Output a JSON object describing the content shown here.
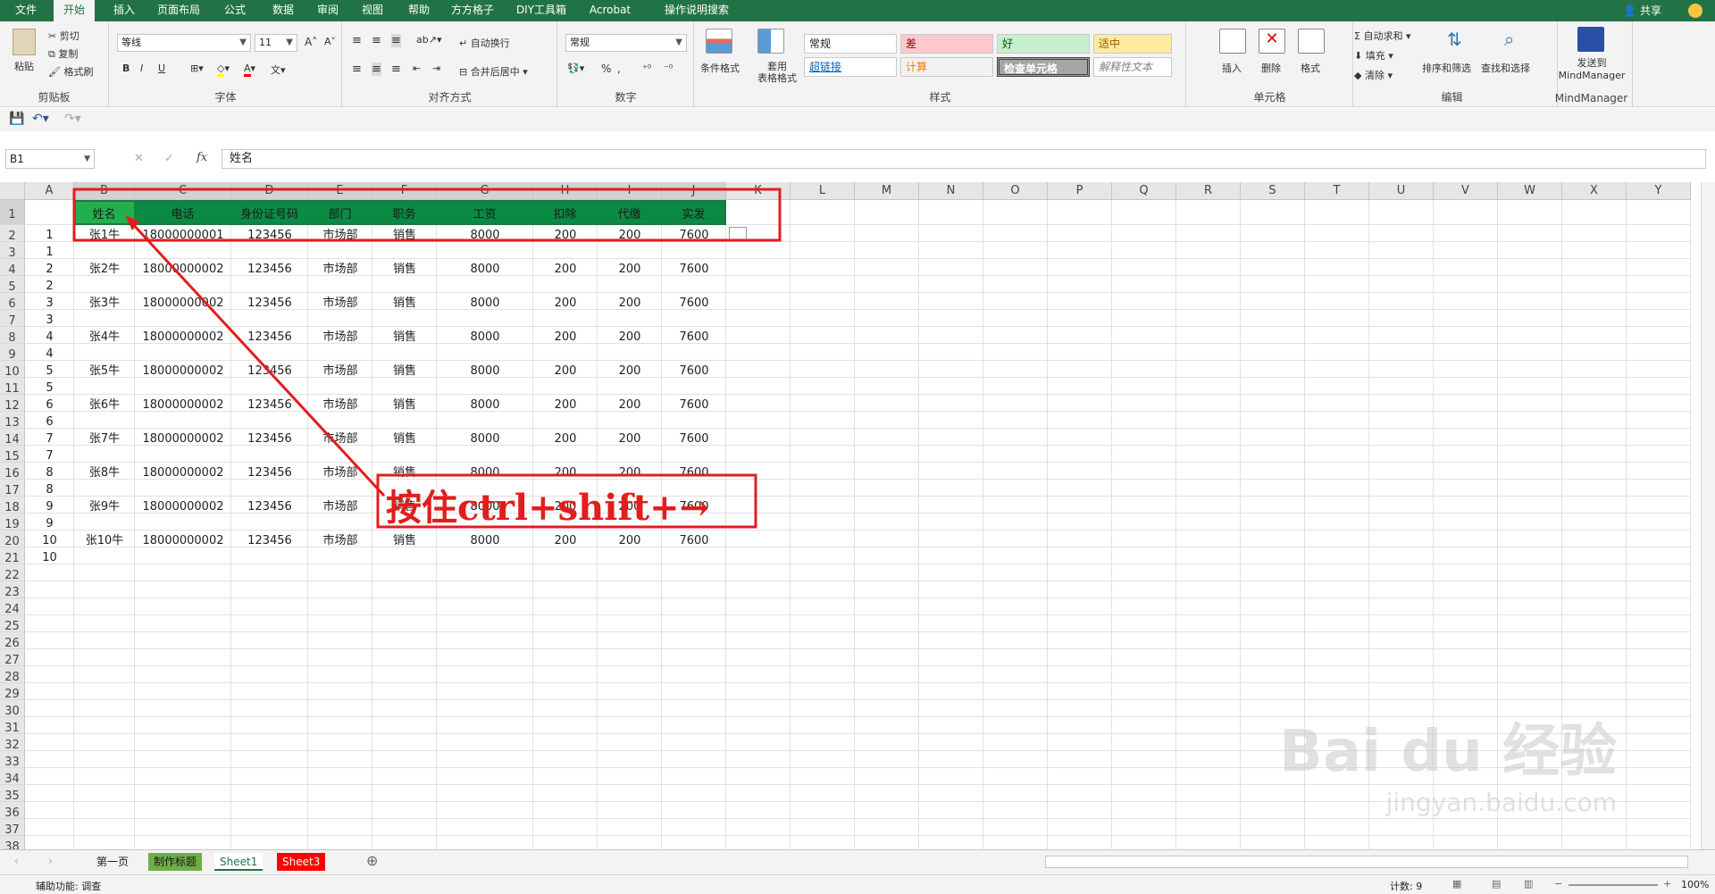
{
  "ribbon_tabs": [
    "文件",
    "开始",
    "插入",
    "页面布局",
    "公式",
    "数据",
    "审阅",
    "视图",
    "帮助",
    "方方格子",
    "DIY工具箱",
    "Acrobat",
    "操作说明搜索"
  ],
  "active_tab": "开始",
  "share_label": "共享",
  "clipboard": {
    "paste": "粘贴",
    "cut": "剪切",
    "copy": "复制",
    "format_painter": "格式刷",
    "label": "剪贴板"
  },
  "font": {
    "name": "等线",
    "size": "11",
    "label": "字体",
    "bold": "B",
    "italic": "I",
    "underline": "U"
  },
  "alignment": {
    "wrap": "自动换行",
    "merge": "合并后居中",
    "label": "对齐方式"
  },
  "number": {
    "format": "常规",
    "percent": "%",
    "comma": ",",
    "label": "数字"
  },
  "styles": {
    "conditional": "条件格式",
    "table": "套用\n表格格式",
    "items": [
      "常规",
      "差",
      "好",
      "适中",
      "超链接",
      "计算",
      "检查单元格",
      "解释性文本"
    ],
    "label": "样式"
  },
  "cells": {
    "insert": "插入",
    "delete": "删除",
    "format": "格式",
    "label": "单元格"
  },
  "editing": {
    "autosum": "自动求和",
    "fill": "填充",
    "clear": "清除",
    "sort": "排序和筛选",
    "find": "查找和选择",
    "label": "编辑"
  },
  "mindmanager": {
    "send": "发送到\nMindManager",
    "label": "MindManager"
  },
  "name_box": "B1",
  "formula_value": "姓名",
  "columns": [
    "A",
    "B",
    "C",
    "D",
    "E",
    "F",
    "G",
    "H",
    "I",
    "J",
    "K",
    "L",
    "M",
    "N",
    "O",
    "P",
    "Q",
    "R",
    "S",
    "T",
    "U",
    "V",
    "W",
    "X",
    "Y"
  ],
  "header_row": [
    "姓名",
    "电话",
    "身份证号码",
    "部门",
    "职务",
    "工资",
    "扣除",
    "代缴",
    "实发"
  ],
  "rows": [
    {
      "r": 2,
      "a": "1",
      "b": "张1牛",
      "c": "18000000001",
      "d": "123456",
      "e": "市场部",
      "f": "销售",
      "g": "8000",
      "h": "200",
      "i": "200",
      "j": "7600"
    },
    {
      "r": 3,
      "a": "1"
    },
    {
      "r": 4,
      "a": "2",
      "b": "张2牛",
      "c": "18000000002",
      "d": "123456",
      "e": "市场部",
      "f": "销售",
      "g": "8000",
      "h": "200",
      "i": "200",
      "j": "7600"
    },
    {
      "r": 5,
      "a": "2"
    },
    {
      "r": 6,
      "a": "3",
      "b": "张3牛",
      "c": "18000000002",
      "d": "123456",
      "e": "市场部",
      "f": "销售",
      "g": "8000",
      "h": "200",
      "i": "200",
      "j": "7600"
    },
    {
      "r": 7,
      "a": "3"
    },
    {
      "r": 8,
      "a": "4",
      "b": "张4牛",
      "c": "18000000002",
      "d": "123456",
      "e": "市场部",
      "f": "销售",
      "g": "8000",
      "h": "200",
      "i": "200",
      "j": "7600"
    },
    {
      "r": 9,
      "a": "4"
    },
    {
      "r": 10,
      "a": "5",
      "b": "张5牛",
      "c": "18000000002",
      "d": "123456",
      "e": "市场部",
      "f": "销售",
      "g": "8000",
      "h": "200",
      "i": "200",
      "j": "7600"
    },
    {
      "r": 11,
      "a": "5"
    },
    {
      "r": 12,
      "a": "6",
      "b": "张6牛",
      "c": "18000000002",
      "d": "123456",
      "e": "市场部",
      "f": "销售",
      "g": "8000",
      "h": "200",
      "i": "200",
      "j": "7600"
    },
    {
      "r": 13,
      "a": "6"
    },
    {
      "r": 14,
      "a": "7",
      "b": "张7牛",
      "c": "18000000002",
      "d": "123456",
      "e": "市场部",
      "f": "销售",
      "g": "8000",
      "h": "200",
      "i": "200",
      "j": "7600"
    },
    {
      "r": 15,
      "a": "7"
    },
    {
      "r": 16,
      "a": "8",
      "b": "张8牛",
      "c": "18000000002",
      "d": "123456",
      "e": "市场部",
      "f": "销售",
      "g": "8000",
      "h": "200",
      "i": "200",
      "j": "7600"
    },
    {
      "r": 17,
      "a": "8"
    },
    {
      "r": 18,
      "a": "9",
      "b": "张9牛",
      "c": "18000000002",
      "d": "123456",
      "e": "市场部",
      "f": "销售",
      "g": "8000",
      "h": "200",
      "i": "200",
      "j": "7600"
    },
    {
      "r": 19,
      "a": "9"
    },
    {
      "r": 20,
      "a": "10",
      "b": "张10牛",
      "c": "18000000002",
      "d": "123456",
      "e": "市场部",
      "f": "销售",
      "g": "8000",
      "h": "200",
      "i": "200",
      "j": "7600"
    },
    {
      "r": 21,
      "a": "10"
    }
  ],
  "annotation": "按住ctrl+shift+→",
  "sheet_tabs": [
    {
      "name": "第一页",
      "bg": "#f3f3f3",
      "color": "#222"
    },
    {
      "name": "制作标题",
      "bg": "#70ad47",
      "color": "#1a1a1a"
    },
    {
      "name": "Sheet1",
      "bg": "#ffffff",
      "color": "#217346"
    },
    {
      "name": "Sheet3",
      "bg": "#ff0000",
      "color": "#ffffff"
    }
  ],
  "status": {
    "accessibility": "辅助功能: 调查",
    "count": "计数: 9",
    "zoom": "100%"
  },
  "watermark": {
    "main": "Bai du 经验",
    "sub": "jingyan.baidu.com"
  },
  "colors": {
    "excel_green": "#217346",
    "header_fill": "#0b8a43",
    "annot_red": "#e31d1d"
  }
}
